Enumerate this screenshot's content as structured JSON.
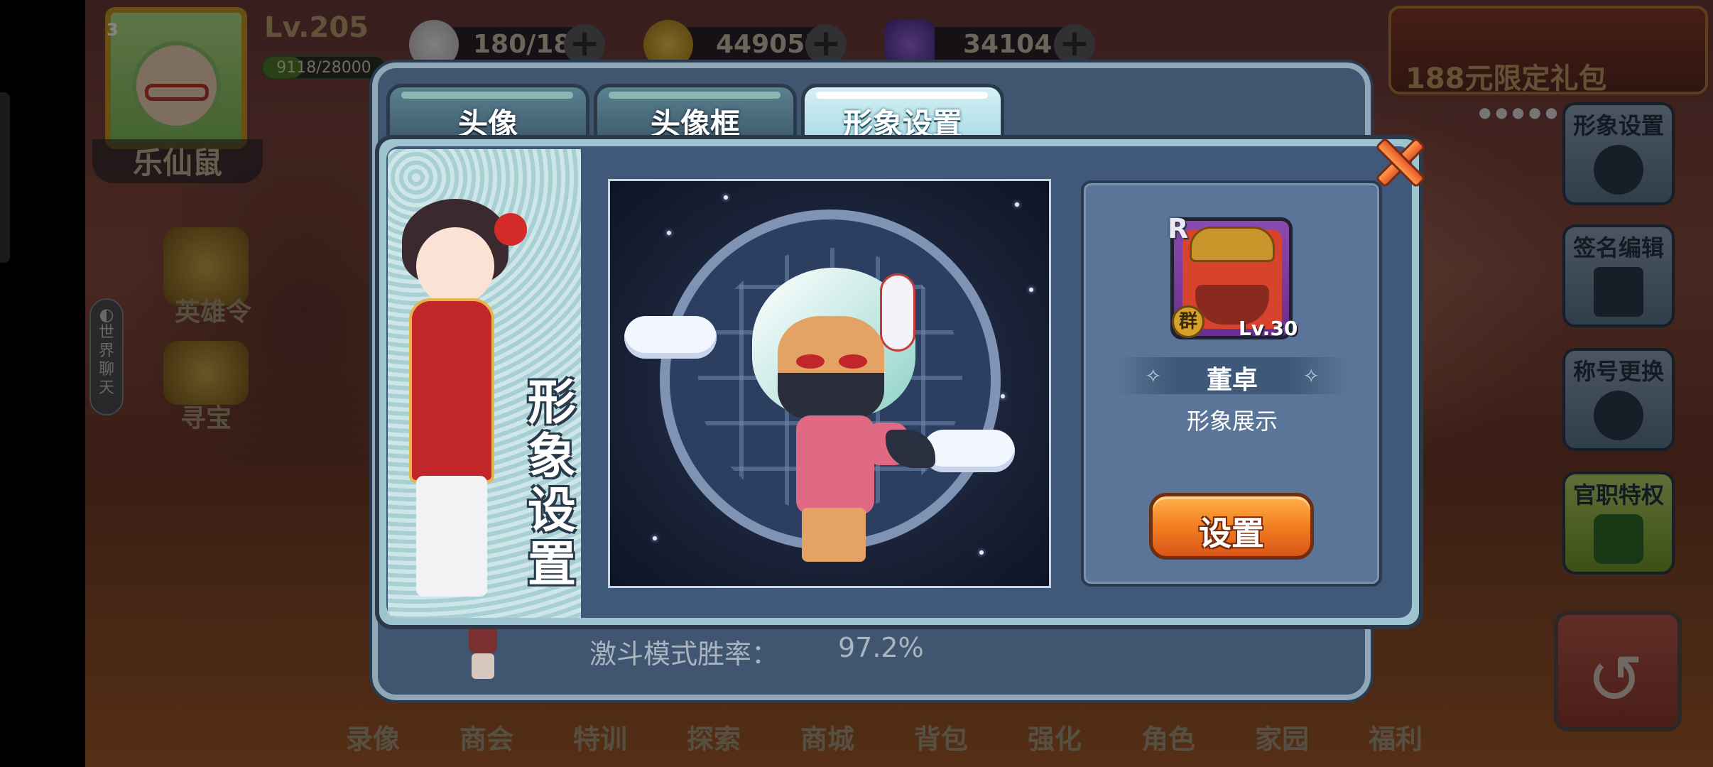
{
  "hud": {
    "player_name": "乐仙鼠",
    "level": "Lv.205",
    "rank_badge": "3",
    "exp_text": "9118/28000",
    "exp_progress": 0.3256,
    "stamina": "180/185",
    "gold": "449053",
    "diamonds": "34104",
    "plus": "+",
    "gift_pack": "188元限定礼包"
  },
  "left_icons": {
    "hero_order": "英雄令",
    "treasure": "寻宝",
    "world_chat": [
      "世",
      "界",
      "聊",
      "天"
    ]
  },
  "right_buttons": [
    {
      "label": "形象设置",
      "icon": "figure-icon"
    },
    {
      "label": "签名编辑",
      "icon": "pen-icon"
    },
    {
      "label": "称号更换",
      "icon": "medal-icon"
    },
    {
      "label": "官职特权",
      "icon": "hat-icon"
    }
  ],
  "bottom_nav": [
    "录像",
    "商会",
    "特训",
    "探索",
    "商城",
    "背包",
    "强化",
    "角色",
    "家园",
    "福利"
  ],
  "background_panel": {
    "win_rate_label": "激斗模式胜率：",
    "win_rate_value": "97.2%"
  },
  "dialog": {
    "tabs": [
      {
        "label": "头像",
        "active": false
      },
      {
        "label": "头像框",
        "active": false
      },
      {
        "label": "形象设置",
        "active": true
      }
    ],
    "side_title": [
      "形",
      "象",
      "设",
      "置"
    ],
    "hero": {
      "rarity": "R",
      "group_badge": "群",
      "level": "Lv.30",
      "name": "董卓",
      "subtitle": "形象展示"
    },
    "set_button": "设置",
    "close_icon": "close-icon"
  },
  "colors": {
    "dialog_bg": "#40597a",
    "tab_active": "#a8dbe6",
    "set_button": "#f07a1e",
    "close_button": "#e4572a"
  }
}
